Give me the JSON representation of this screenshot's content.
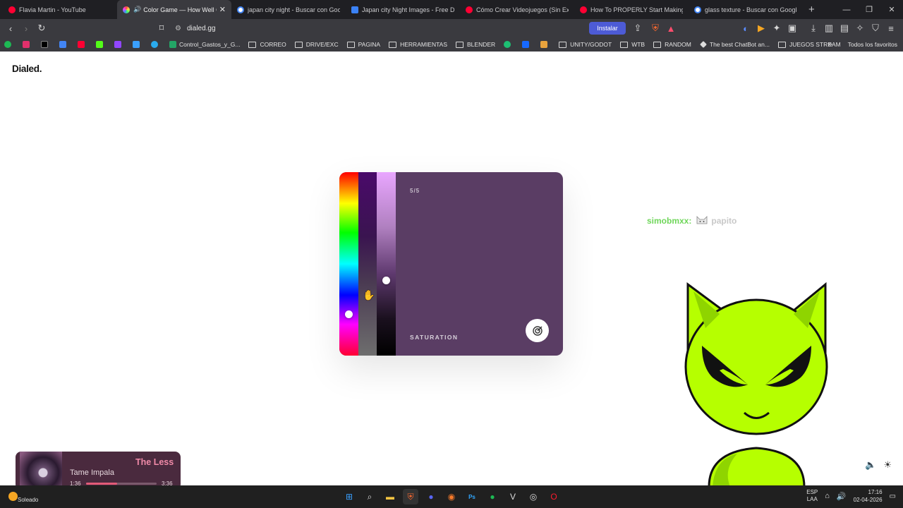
{
  "browser": {
    "tabs": [
      {
        "title": "Flavia Martin - YouTube",
        "color": "#ff0033"
      },
      {
        "title": "Color Game — How Well Can",
        "color": "#e040fb",
        "active": true
      },
      {
        "title": "japan city night - Buscar con Google",
        "color": "#4285f4"
      },
      {
        "title": "Japan city Night Images - Free Down",
        "color": "#3b82f6"
      },
      {
        "title": "Cómo Crear Videojuegos (Sin Experi",
        "color": "#ff0033"
      },
      {
        "title": "How To PROPERLY Start Making A G",
        "color": "#ff0033"
      },
      {
        "title": "glass texture - Buscar con Google",
        "color": "#4285f4"
      }
    ],
    "url": "dialed.gg",
    "install_label": "Instalar",
    "bookmarks": [
      "Control_Gastos_y_G...",
      "CORREO",
      "DRIVE/EXC",
      "PAGINA",
      "HERRAMIENTAS",
      "BLENDER",
      "UNITY/GODOT",
      "WTB",
      "RANDOM",
      "The best ChatBot an...",
      "JUEGOS STREAM"
    ],
    "all_bookmarks": "Todos los favoritos"
  },
  "page": {
    "brand": "Dialed.",
    "card": {
      "counter": "5/5",
      "mode_label": "SATURATION",
      "color": "#5a3d64"
    },
    "chat": {
      "user1": "simobmxx:",
      "user2": "papito"
    }
  },
  "music": {
    "song": "The Less",
    "artist": "Tame Impala",
    "elapsed": "1:36",
    "duration": "3:36",
    "progress": 0.44
  },
  "taskbar": {
    "weather": "Soleado",
    "lang1": "ESP",
    "lang2": "LAA",
    "time": "17:16",
    "date": "02-04-2026"
  }
}
